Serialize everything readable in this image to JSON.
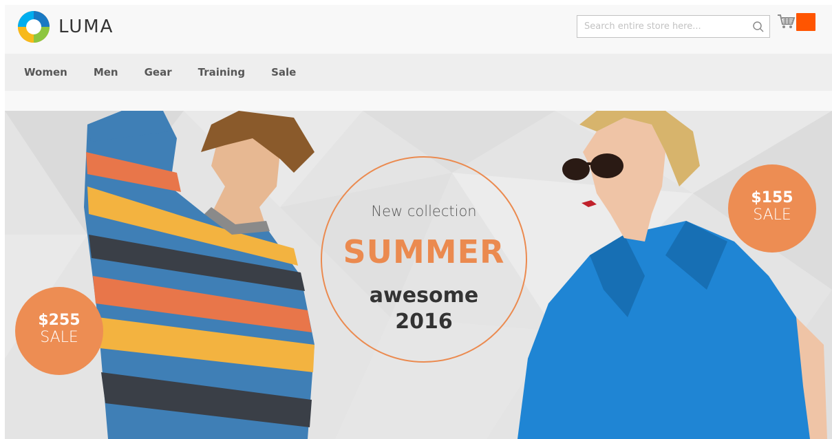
{
  "brand": {
    "name": "LUMA",
    "logo_icon": "luma-logo-icon"
  },
  "search": {
    "placeholder": "Search entire store here...",
    "value": "",
    "icon": "search-icon"
  },
  "cart": {
    "icon": "cart-icon",
    "count": ""
  },
  "nav": {
    "items": [
      {
        "label": "Women"
      },
      {
        "label": "Men"
      },
      {
        "label": "Gear"
      },
      {
        "label": "Training"
      },
      {
        "label": "Sale"
      }
    ]
  },
  "banner": {
    "tagline": "New collection",
    "headline": "SUMMER",
    "subline1": "awesome",
    "subline2": "2016",
    "badge_left": {
      "price": "$255",
      "label": "SALE"
    },
    "badge_right": {
      "price": "$155",
      "label": "SALE"
    }
  },
  "colors": {
    "accent": "#eb8a4f",
    "cart_badge": "#ff5501",
    "header_bg": "#f8f8f8",
    "nav_bg": "#eeeeee"
  }
}
